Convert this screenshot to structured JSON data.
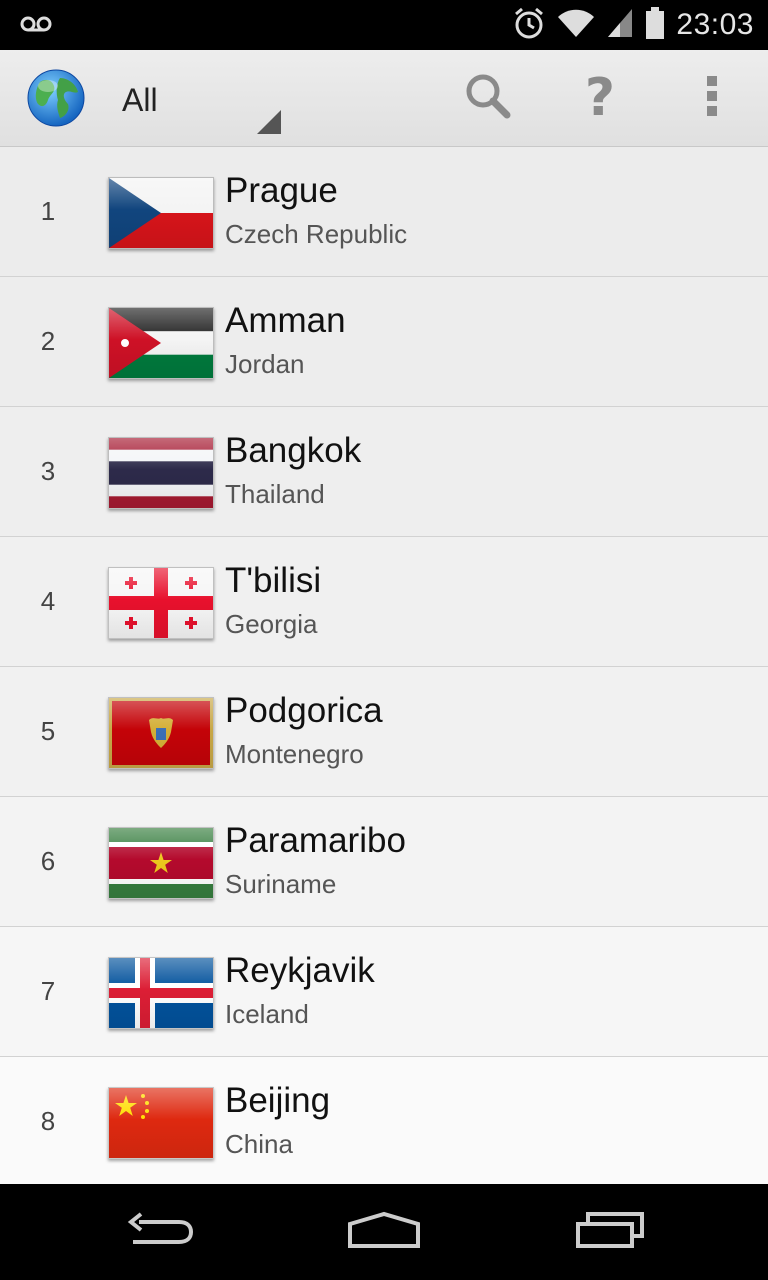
{
  "status_bar": {
    "time": "23:03",
    "icons": [
      "voicemail-icon",
      "alarm-icon",
      "wifi-icon",
      "signal-icon",
      "battery-icon"
    ]
  },
  "action_bar": {
    "app_icon": "globe-icon",
    "filter_selected": "All",
    "actions": [
      "search-icon",
      "help-icon",
      "overflow-menu-icon"
    ],
    "help_glyph": "?"
  },
  "cities": [
    {
      "rank": "1",
      "city": "Prague",
      "country": "Czech Republic",
      "flag": "czech-republic-flag-icon"
    },
    {
      "rank": "2",
      "city": "Amman",
      "country": "Jordan",
      "flag": "jordan-flag-icon"
    },
    {
      "rank": "3",
      "city": "Bangkok",
      "country": "Thailand",
      "flag": "thailand-flag-icon"
    },
    {
      "rank": "4",
      "city": "T'bilisi",
      "country": "Georgia",
      "flag": "georgia-flag-icon"
    },
    {
      "rank": "5",
      "city": "Podgorica",
      "country": "Montenegro",
      "flag": "montenegro-flag-icon"
    },
    {
      "rank": "6",
      "city": "Paramaribo",
      "country": "Suriname",
      "flag": "suriname-flag-icon"
    },
    {
      "rank": "7",
      "city": "Reykjavik",
      "country": "Iceland",
      "flag": "iceland-flag-icon"
    },
    {
      "rank": "8",
      "city": "Beijing",
      "country": "China",
      "flag": "china-flag-icon"
    }
  ],
  "nav_bar": {
    "buttons": [
      "back-icon",
      "home-icon",
      "recent-apps-icon"
    ]
  },
  "colors": {
    "status_bar_bg": "#000000",
    "action_bar_bg": "#e6e6e6",
    "list_bg": "#f5f5f5",
    "divider": "#d2d2d2"
  }
}
